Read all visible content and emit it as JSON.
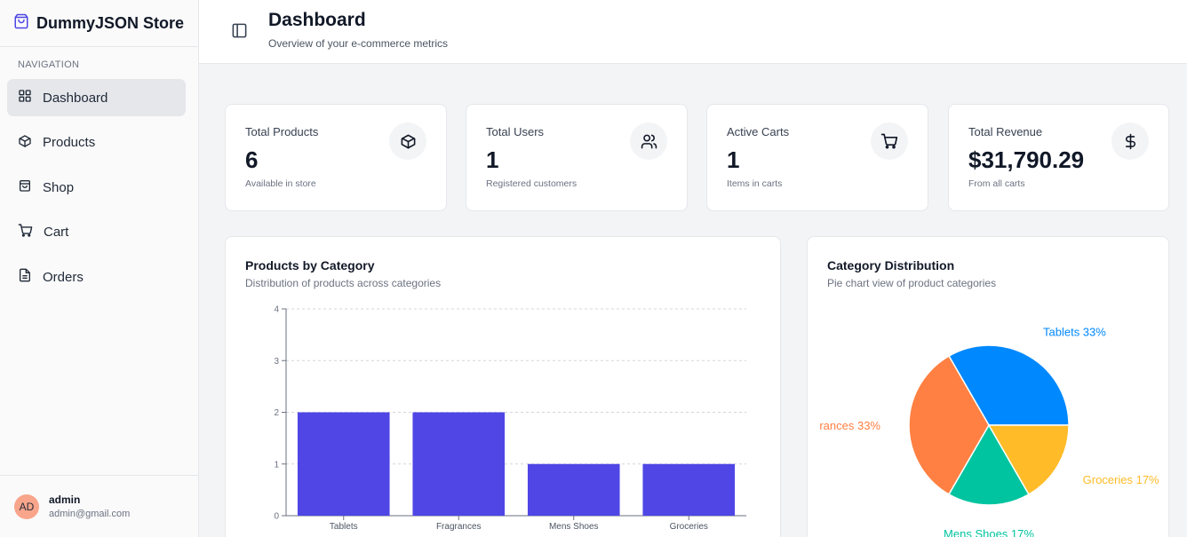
{
  "app": {
    "brand": "DummyJSON Store"
  },
  "sidebar": {
    "heading": "NAVIGATION",
    "items": [
      {
        "label": "Dashboard",
        "icon": "dashboard-grid-icon",
        "active": true
      },
      {
        "label": "Products",
        "icon": "box-icon"
      },
      {
        "label": "Shop",
        "icon": "shopping-bag-icon"
      },
      {
        "label": "Cart",
        "icon": "cart-icon"
      },
      {
        "label": "Orders",
        "icon": "document-icon"
      }
    ],
    "user": {
      "initials": "AD",
      "name": "admin",
      "email": "admin@gmail.com"
    }
  },
  "header": {
    "title": "Dashboard",
    "subtitle": "Overview of your e-commerce metrics"
  },
  "stats": [
    {
      "label": "Total Products",
      "value": "6",
      "note": "Available in store",
      "icon": "box-icon"
    },
    {
      "label": "Total Users",
      "value": "1",
      "note": "Registered customers",
      "icon": "users-icon"
    },
    {
      "label": "Active Carts",
      "value": "1",
      "note": "Items in carts",
      "icon": "cart-icon"
    },
    {
      "label": "Total Revenue",
      "value": "$31,790.29",
      "note": "From all carts",
      "icon": "dollar-icon"
    }
  ],
  "bar_panel": {
    "title": "Products by Category",
    "subtitle": "Distribution of products across categories"
  },
  "pie_panel": {
    "title": "Category Distribution",
    "subtitle": "Pie chart view of product categories"
  },
  "colors": {
    "bar": "#4f46e5",
    "pie": [
      "#0088fe",
      "#ff8042",
      "#00c49f",
      "#ffbb28"
    ]
  },
  "chart_data": [
    {
      "type": "bar",
      "categories": [
        "Tablets",
        "Fragrances",
        "Mens Shoes",
        "Groceries"
      ],
      "values": [
        2,
        2,
        1,
        1
      ],
      "yticks": [
        0,
        1,
        2,
        3,
        4
      ],
      "ylim": [
        0,
        4
      ],
      "grid": true
    },
    {
      "type": "pie",
      "slices": [
        {
          "label": "Tablets 33%",
          "value": 2
        },
        {
          "label": "rances 33%",
          "value": 2
        },
        {
          "label": "Mens Shoes 17%",
          "value": 1
        },
        {
          "label": "Groceries 17%",
          "value": 1
        }
      ]
    }
  ]
}
